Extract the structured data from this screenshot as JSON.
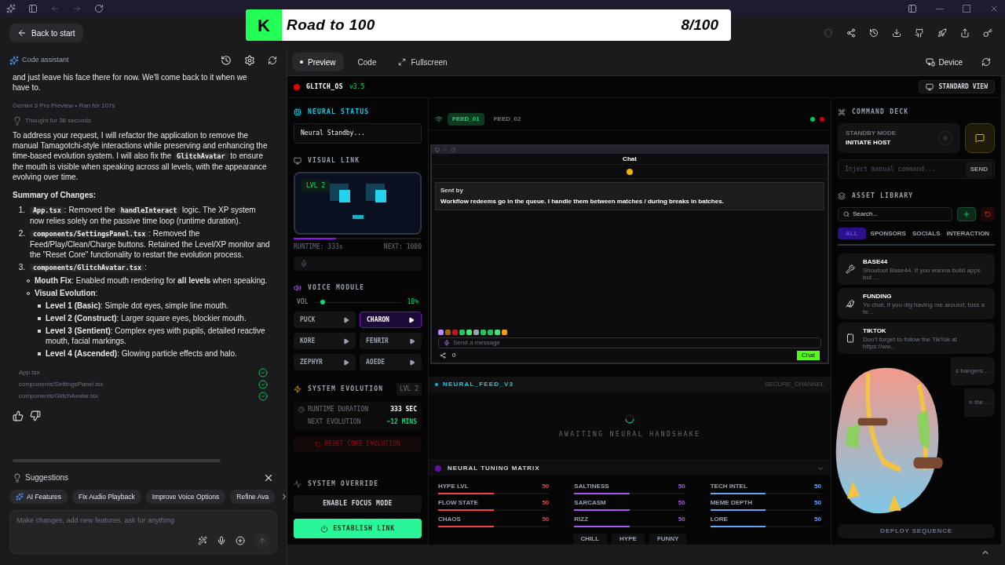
{
  "banner": {
    "badge": "K",
    "title": "Road to 100",
    "count": "8/100"
  },
  "back_button": "Back to start",
  "assistant": {
    "title": "Code assistant",
    "intro": "and just leave his face there for now. We'll come back to it when we have to.",
    "meta": "Gemini 3 Pro Preview  •  Ran for 107s",
    "thought": "Thought for 38 seconds",
    "paragraph": [
      {
        "kind": "text",
        "text": "To address your request, I will refactor the application to remove the manual Tamagotchi-style interactions while preserving and enhancing the time-based evolution system. I will also fix the "
      },
      {
        "kind": "code",
        "text": "GlitchAvatar"
      },
      {
        "kind": "text",
        "text": " to ensure the mouth is visible when speaking across all levels, with the appearance evolving over time."
      }
    ],
    "summary_title": "Summary of Changes:",
    "list": [
      {
        "marker": "1.",
        "segments": [
          {
            "kind": "code",
            "text": "App.tsx"
          },
          {
            "kind": "text",
            "text": ": Removed the "
          },
          {
            "kind": "code",
            "text": "handleInteract"
          },
          {
            "kind": "text",
            "text": " logic. The XP system now relies solely on the passive time loop (runtime duration)."
          }
        ]
      },
      {
        "marker": "2.",
        "segments": [
          {
            "kind": "code",
            "text": "components/SettingsPanel.tsx"
          },
          {
            "kind": "text",
            "text": ": Removed the Feed/Play/Clean/Charge buttons. Retained the Level/XP monitor and the \"Reset Core\" functionality to restart the evolution process."
          }
        ]
      },
      {
        "marker": "3.",
        "segments": [
          {
            "kind": "code",
            "text": "components/GlitchAvatar.tsx"
          },
          {
            "kind": "text",
            "text": ":"
          }
        ],
        "children": [
          {
            "segments": [
              {
                "kind": "text",
                "text": "**Mouth Fix**: Enabled mouth rendering for **all levels** when speaking."
              }
            ]
          },
          {
            "segments": [
              {
                "kind": "text",
                "text": "**Visual Evolution**:"
              }
            ],
            "children": [
              {
                "segments": [
                  {
                    "kind": "text",
                    "text": "**Level 1 (Basic)**: Simple dot eyes, simple line mouth."
                  }
                ]
              },
              {
                "segments": [
                  {
                    "kind": "text",
                    "text": "**Level 2 (Construct)**: Larger square eyes, blockier mouth."
                  }
                ]
              },
              {
                "segments": [
                  {
                    "kind": "text",
                    "text": "**Level 3 (Sentient)**: Complex eyes with pupils, detailed reactive mouth, facial markings."
                  }
                ]
              },
              {
                "segments": [
                  {
                    "kind": "text",
                    "text": "**Level 4 (Ascended)**: Glowing particle effects and halo."
                  }
                ]
              }
            ]
          }
        ]
      }
    ],
    "files": [
      {
        "name": "App.tsx",
        "done": true
      },
      {
        "name": "components/SettingsPanel.tsx",
        "done": true
      },
      {
        "name": "components/GlitchAvatar.tsx",
        "done": true
      }
    ],
    "suggestions_title": "Suggestions",
    "suggestions": [
      {
        "label": "AI Features",
        "kind": "ai"
      },
      {
        "label": "Fix Audio Playback",
        "kind": "plain"
      },
      {
        "label": "Improve Voice Options",
        "kind": "plain"
      },
      {
        "label": "Refine Ava",
        "kind": "plain"
      }
    ],
    "prompt_placeholder": "Make changes, add new features, ask for anything"
  },
  "preview_tabs": [
    {
      "label": "Preview",
      "selected": true,
      "kind": "dot"
    },
    {
      "label": "Code",
      "selected": false,
      "kind": "plain"
    },
    {
      "label": "Fullscreen",
      "selected": false,
      "kind": "expand"
    }
  ],
  "device_button": "Device",
  "app": {
    "name": "GLITCH_OS",
    "version": "v3.5",
    "view_button": "STANDARD VIEW",
    "neural_status": {
      "label": "NEURAL STATUS",
      "value": "Neural Standby..."
    },
    "visual_link": {
      "label": "VISUAL LINK",
      "level_badge": "LVL 2",
      "progress": {
        "level": 0.33
      },
      "runtime": "RUNTIME: 333s",
      "next": "NEXT: 1000"
    },
    "voice": {
      "label": "VOICE MODULE",
      "vol_label": "VOL",
      "volume": {
        "level": 0.1
      },
      "vol_reading": "10%",
      "voices": [
        {
          "name": "PUCK",
          "selected": false
        },
        {
          "name": "CHARON",
          "selected": true
        },
        {
          "name": "KORE",
          "selected": false
        },
        {
          "name": "FENRIR",
          "selected": false
        },
        {
          "name": "ZEPHYR",
          "selected": false
        },
        {
          "name": "AOEDE",
          "selected": false
        }
      ]
    },
    "evolution": {
      "label": "SYSTEM EVOLUTION",
      "badge": "LVL 2",
      "rows": [
        {
          "label": "RUNTIME DURATION",
          "value": "333 SEC",
          "kind": "white"
        },
        {
          "label": "NEXT EVOLUTION",
          "value": "~12 MINS",
          "kind": "green"
        }
      ],
      "reset": "RESET CORE EVOLUTION"
    },
    "override": {
      "label": "SYSTEM OVERRIDE",
      "focus": "ENABLE FOCUS MODE",
      "link": "ESTABLISH LINK"
    },
    "feeds": [
      {
        "label": "FEED_01",
        "selected": true
      },
      {
        "label": "FEED_02",
        "selected": false
      }
    ],
    "stream": {
      "title": "Chat",
      "sent_by": "Sent by",
      "pinned": "Workflow redeems go in the queue. I handle them between matches / during breaks in batches.",
      "input_placeholder": "Send a message",
      "count": "0",
      "chat_button": "Chat"
    },
    "neural_feed": {
      "title": "NEURAL_FEED_V3",
      "channel": "SECURE_CHANNEL",
      "waiting": "AWAITING NEURAL HANDSHAKE"
    },
    "tuning": {
      "title": "NEURAL TUNING MATRIX",
      "sliders": [
        {
          "label": "HYPE LVL",
          "value": "50",
          "level": 0.5,
          "color": "#ef4444"
        },
        {
          "label": "SALTINESS",
          "value": "50",
          "level": 0.5,
          "color": "#a855f7"
        },
        {
          "label": "TECH INTEL",
          "value": "50",
          "level": 0.5,
          "color": "#60a5fa"
        },
        {
          "label": "FLOW STATE",
          "value": "50",
          "level": 0.5,
          "color": "#ef4444"
        },
        {
          "label": "SARCASM",
          "value": "50",
          "level": 0.5,
          "color": "#a855f7"
        },
        {
          "label": "MEME DEPTH",
          "value": "50",
          "level": 0.5,
          "color": "#60a5fa"
        },
        {
          "label": "CHAOS",
          "value": "50",
          "level": 0.5,
          "color": "#ef4444"
        },
        {
          "label": "RIZZ",
          "value": "50",
          "level": 0.5,
          "color": "#a855f7"
        },
        {
          "label": "LORE",
          "value": "50",
          "level": 0.5,
          "color": "#60a5fa"
        }
      ],
      "presets": [
        "CHILL",
        "HYPE",
        "FUNNY"
      ]
    },
    "command_deck": {
      "label": "COMMAND DECK",
      "mode": "STANDBY MODE",
      "action": "INITIATE HOST",
      "input_placeholder": "Inject manual command...",
      "send": "SEND"
    },
    "assets": {
      "label": "ASSET LIBRARY",
      "search_placeholder": "Search...",
      "filters": [
        {
          "label": "ALL",
          "selected": true
        },
        {
          "label": "SPONSORS",
          "selected": false
        },
        {
          "label": "SOCIALS",
          "selected": false
        },
        {
          "label": "INTERACTION",
          "selected": false
        }
      ],
      "items": [
        {
          "title": "BASE44",
          "text": "Shoutout Base44. If you wanna build apps but ...",
          "kind": "tools"
        },
        {
          "title": "FUNDING",
          "text": "Yo chat, if you dig having me around, toss a fe...",
          "kind": "bird"
        },
        {
          "title": "TIKTOK",
          "text": "Don't forget to follow the TikTok at https://ww...",
          "kind": "phone"
        },
        {
          "text": "s bangers ...",
          "kind": "covered"
        },
        {
          "text": "n the ...",
          "kind": "covered"
        }
      ],
      "deploy": "DEPLOY SEQUENCE"
    }
  }
}
